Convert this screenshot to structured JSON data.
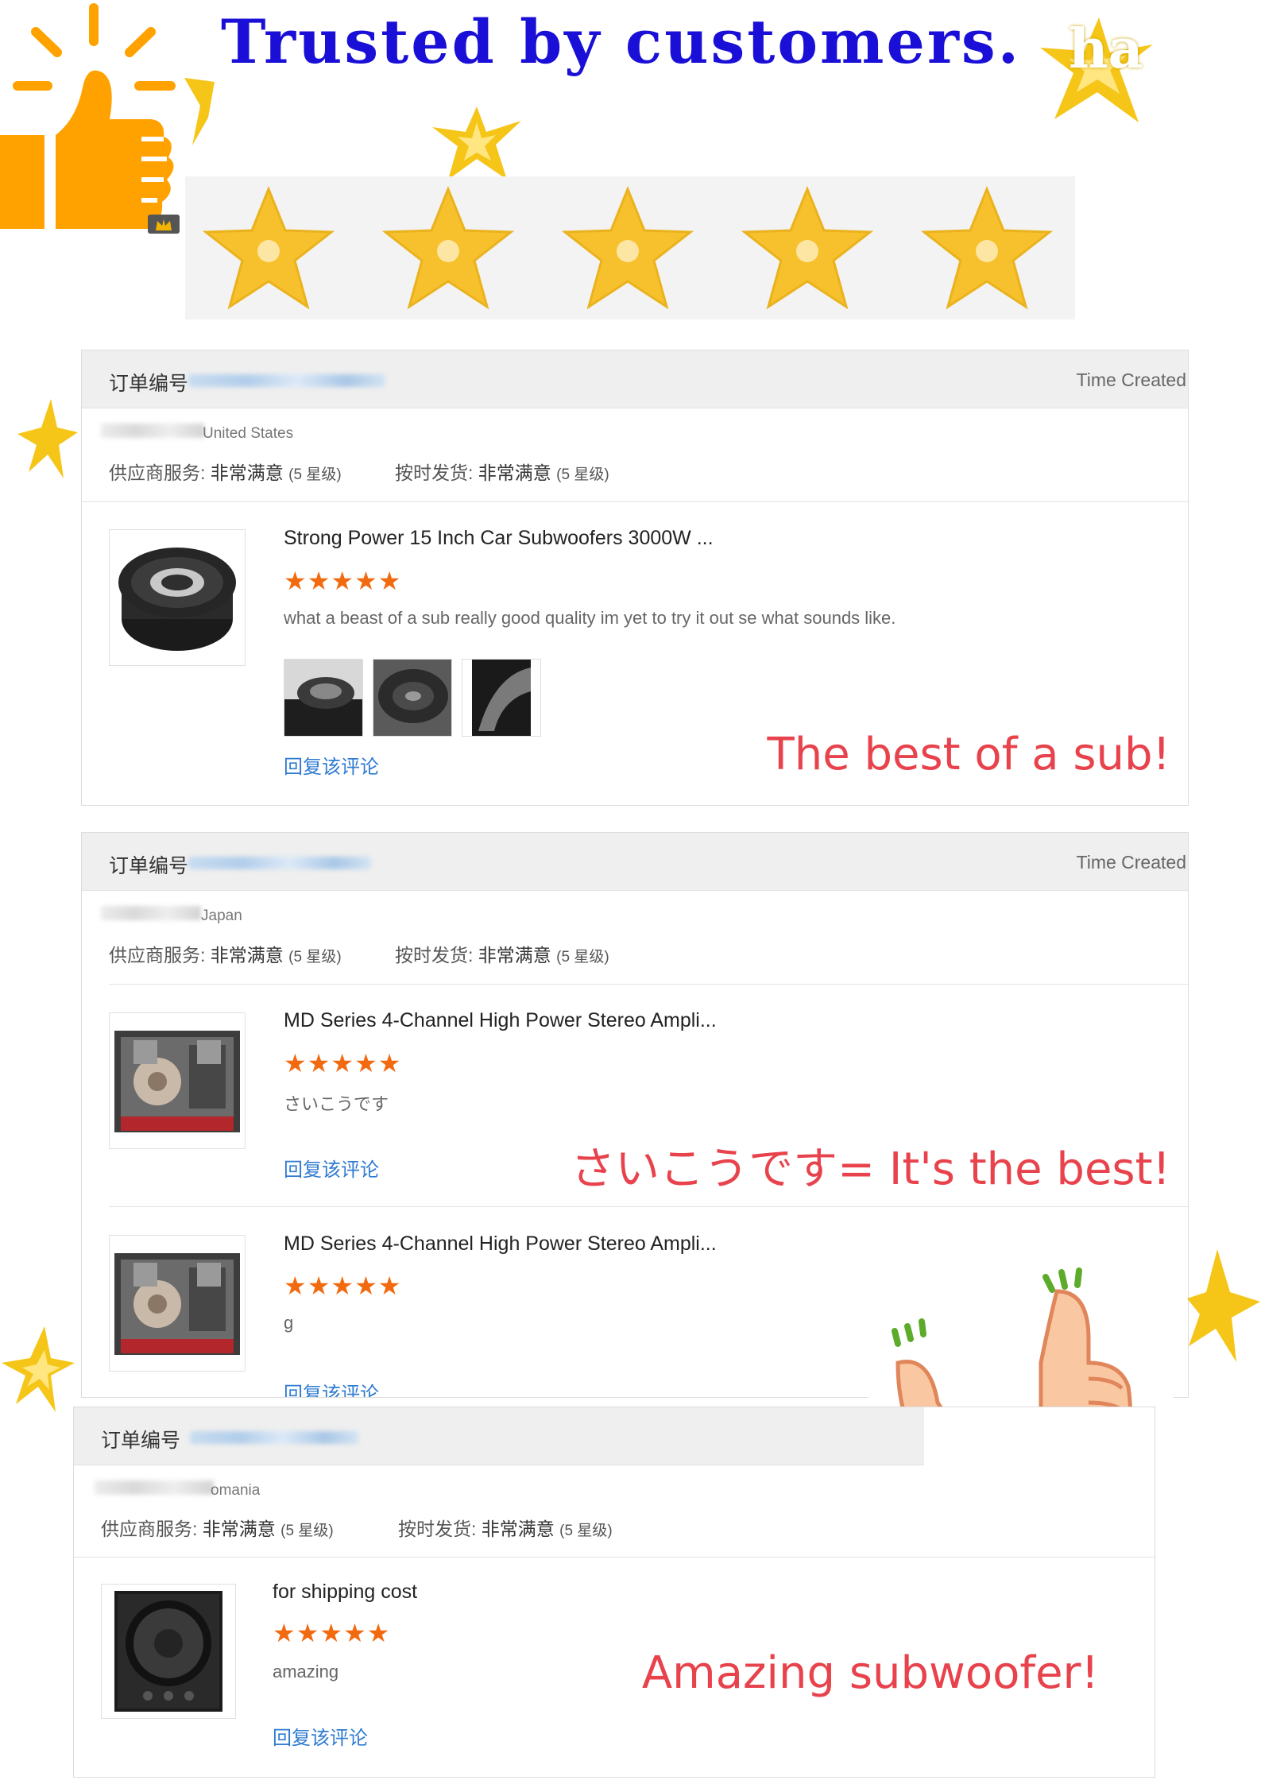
{
  "header": {
    "title": "Trusted by customers.",
    "ha_text": "ha"
  },
  "labels": {
    "order_number": "订单编号",
    "time_created": "Time Created",
    "supplier_service": "供应商服务:",
    "ontime_shipping": "按时发货:",
    "very_satisfied": "非常满意",
    "five_stars": "(5 星级)",
    "reply": "回复该评论",
    "stars": "★★★★★"
  },
  "reviews": [
    {
      "country": "United States",
      "product_title": "Strong Power 15 Inch Car Subwoofers 3000W ...",
      "comment": "what a beast of a sub really good quality im yet to try it out se what sounds like.",
      "callout": "The best of a sub!"
    },
    {
      "country": "Japan",
      "items": [
        {
          "product_title": "MD Series 4-Channel High Power Stereo Ampli...",
          "comment": "さいこうです"
        },
        {
          "product_title": "MD Series 4-Channel High Power Stereo Ampli...",
          "comment": "g"
        }
      ],
      "callout": "さいこうです= It's the best!"
    },
    {
      "country": "omania",
      "product_title": "for shipping cost",
      "comment": "amazing",
      "callout": "Amazing subwoofer!"
    }
  ],
  "colors": {
    "title_blue": "#1a0fd6",
    "star_gold": "#f7c02d",
    "rating_orange": "#f26a10",
    "reply_blue": "#2f7bd1",
    "callout_red": "#e8434c",
    "thumb_orange": "#ffa200"
  },
  "icons": [
    "thumbs-up-icon",
    "sparkle-star-icon",
    "star-icon",
    "crown-icon",
    "thumbs-up-hands-icon"
  ]
}
